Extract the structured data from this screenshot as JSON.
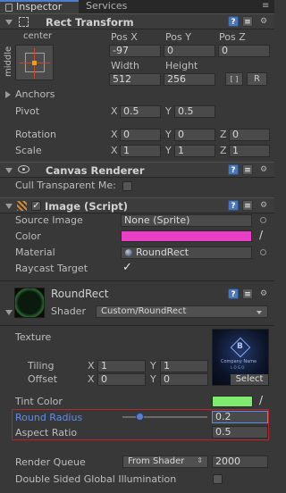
{
  "tabs": [
    {
      "label": "Inspector"
    },
    {
      "label": "Services"
    }
  ],
  "rect_transform": {
    "title": "Rect Transform",
    "anchor_h": "center",
    "anchor_v": "middle",
    "pos_x_label": "Pos X",
    "pos_y_label": "Pos Y",
    "pos_z_label": "Pos Z",
    "pos_x": "-97",
    "pos_y": "0",
    "pos_z": "0",
    "width_label": "Width",
    "height_label": "Height",
    "width": "512",
    "height": "256",
    "blueprint_button": "[ ]",
    "raw_button": "R",
    "anchors_label": "Anchors",
    "pivot_label": "Pivot",
    "pivot_x_label": "X",
    "pivot_x": "0.5",
    "pivot_y_label": "Y",
    "pivot_y": "0.5",
    "rotation_label": "Rotation",
    "rot_x_label": "X",
    "rot_x": "0",
    "rot_y_label": "Y",
    "rot_y": "0",
    "rot_z_label": "Z",
    "rot_z": "0",
    "scale_label": "Scale",
    "scale_x_label": "X",
    "scale_x": "1",
    "scale_y_label": "Y",
    "scale_y": "1",
    "scale_z_label": "Z",
    "scale_z": "1"
  },
  "canvas_renderer": {
    "title": "Canvas Renderer",
    "cull_label": "Cull Transparent Me:",
    "cull_checked": false
  },
  "image_script": {
    "title": "Image (Script)",
    "enabled": true,
    "source_image_label": "Source Image",
    "source_image_value": "None (Sprite)",
    "color_label": "Color",
    "color_value": "#e93fc6",
    "material_label": "Material",
    "material_value": "RoundRect",
    "raycast_label": "Raycast Target",
    "raycast_checked": true
  },
  "material": {
    "name": "RoundRect",
    "shader_label": "Shader",
    "shader_value": "Custom/RoundRect",
    "texture_label": "Texture",
    "tiling_label": "Tiling",
    "tiling_x_label": "X",
    "tiling_x": "1",
    "tiling_y_label": "Y",
    "tiling_y": "1",
    "offset_label": "Offset",
    "offset_x_label": "X",
    "offset_x": "0",
    "offset_y_label": "Y",
    "offset_y": "0",
    "select_label": "Select",
    "thumb_text_1": "Company Name",
    "thumb_text_2": "L O G O",
    "tint_label": "Tint Color",
    "tint_value": "#7fea6e",
    "round_radius_label": "Round Radius",
    "round_radius_value": "0.2",
    "round_radius_slider_fraction": 0.2,
    "aspect_label": "Aspect Ratio",
    "aspect_value": "0.5",
    "render_queue_label": "Render Queue",
    "render_queue_mode": "From Shader",
    "render_queue_value": "2000",
    "double_sided_label": "Double Sided Global Illumination",
    "double_sided_checked": false
  },
  "colors": {
    "highlight_outline": "#c0222a",
    "link_blue": "#5b8df0"
  }
}
